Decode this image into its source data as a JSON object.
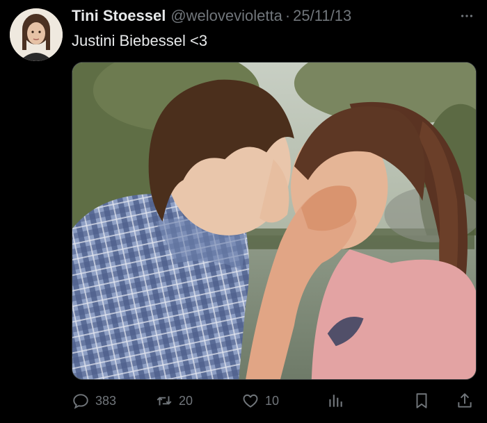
{
  "author": {
    "display_name": "Tini Stoessel",
    "handle": "@weloveviolett­a",
    "separator": "·",
    "date": "25/11/13"
  },
  "tweet": {
    "text": "Justini Biebessel <3"
  },
  "media": {
    "description_icon": "photo",
    "colors": {
      "background_foliage": "#6f7d52",
      "water": "#8a9684",
      "shirt_plaid": "#6a7ea6",
      "pink_top": "#e3a3a3",
      "hair_dark": "#4a2e1e"
    }
  },
  "actions": {
    "reply_count": "383",
    "retweet_count": "20",
    "like_count": "10"
  },
  "icons": {
    "more": "more-horizontal-icon",
    "reply": "reply-icon",
    "retweet": "retweet-icon",
    "like": "heart-icon",
    "views": "views-icon",
    "bookmark": "bookmark-icon",
    "share": "share-icon"
  },
  "theme": {
    "background": "#000000",
    "text_primary": "#e7e9ea",
    "text_secondary": "#71767b"
  }
}
